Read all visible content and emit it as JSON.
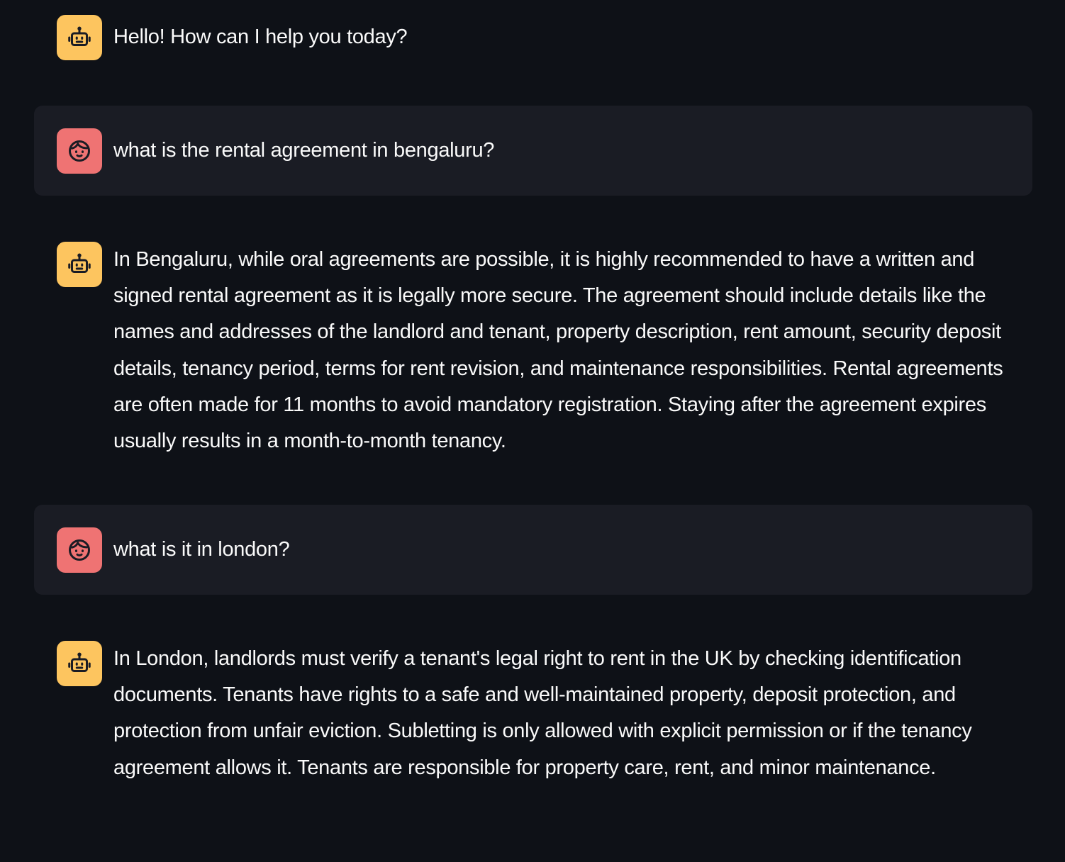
{
  "messages": [
    {
      "role": "assistant",
      "avatar_icon": "robot-icon",
      "text": "Hello! How can I help you today?"
    },
    {
      "role": "user",
      "avatar_icon": "user-face-icon",
      "text": "what is the rental agreement in bengaluru?"
    },
    {
      "role": "assistant",
      "avatar_icon": "robot-icon",
      "text": "In Bengaluru, while oral agreements are possible, it is highly recommended to have a written and signed rental agreement as it is legally more secure. The agreement should include details like the names and addresses of the landlord and tenant, property description, rent amount, security deposit details, tenancy period, terms for rent revision, and maintenance responsibilities. Rental agreements are often made for 11 months to avoid mandatory registration. Staying after the agreement expires usually results in a month-to-month tenancy."
    },
    {
      "role": "user",
      "avatar_icon": "user-face-icon",
      "text": "what is it in london?"
    },
    {
      "role": "assistant",
      "avatar_icon": "robot-icon",
      "text": "In London, landlords must verify a tenant's legal right to rent in the UK by checking identification documents. Tenants have rights to a safe and well-maintained property, deposit protection, and protection from unfair eviction. Subletting is only allowed with explicit permission or if the tenancy agreement allows it. Tenants are responsible for property care, rent, and minor maintenance."
    }
  ],
  "colors": {
    "background": "#0e1117",
    "user_message_bg": "#1a1c24",
    "assistant_avatar": "#fdc55f",
    "user_avatar": "#ef7373",
    "text": "#fafafa"
  }
}
